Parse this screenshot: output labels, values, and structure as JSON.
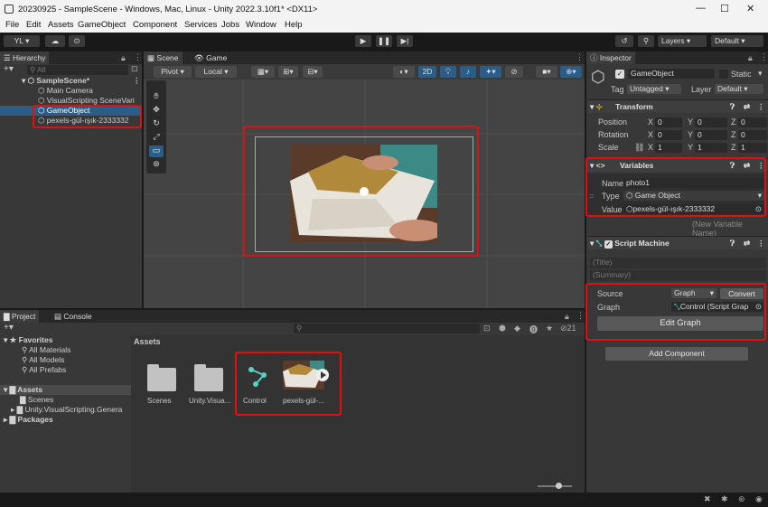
{
  "window": {
    "title": "20230925 - SampleScene - Windows, Mac, Linux - Unity 2022.3.10f1* <DX11>"
  },
  "menu": [
    "File",
    "Edit",
    "Assets",
    "GameObject",
    "Component",
    "Services",
    "Jobs",
    "Window",
    "Help"
  ],
  "toolbar": {
    "account": "YL ▾",
    "layers": "Layers",
    "layout": "Default"
  },
  "hierarchy": {
    "tab": "Hierarchy",
    "search_placeholder": "All",
    "scene": "SampleScene*",
    "items": [
      "Main Camera",
      "VisualScripting SceneVari",
      "GameObject",
      "pexels-gül-ışık-2333332"
    ]
  },
  "scene": {
    "tab_scene": "Scene",
    "tab_game": "Game",
    "pivot": "Pivot",
    "local": "Local",
    "mode_2d": "2D"
  },
  "project": {
    "tab_project": "Project",
    "tab_console": "Console",
    "hidden_count": "21",
    "favorites": "Favorites",
    "fav_items": [
      "All Materials",
      "All Models",
      "All Prefabs"
    ],
    "assets_label": "Assets",
    "asset_tree": [
      "Scenes",
      "Unity.VisualScripting.Genera"
    ],
    "packages": "Packages",
    "breadcrumb": "Assets",
    "grid": [
      "Scenes",
      "Unity.Visua...",
      "Control",
      "pexels-gül-..."
    ]
  },
  "inspector": {
    "tab": "Inspector",
    "object_name": "GameObject",
    "static_label": "Static",
    "tag_label": "Tag",
    "tag_value": "Untagged",
    "layer_label": "Layer",
    "layer_value": "Default",
    "transform": {
      "title": "Transform",
      "rows": [
        {
          "label": "Position",
          "x": "0",
          "y": "0",
          "z": "0"
        },
        {
          "label": "Rotation",
          "x": "0",
          "y": "0",
          "z": "0"
        },
        {
          "label": "Scale",
          "x": "1",
          "y": "1",
          "z": "1"
        }
      ]
    },
    "variables": {
      "title": "Variables",
      "name_label": "Name",
      "name_value": "photo1",
      "type_label": "Type",
      "type_value": "Game Object",
      "value_label": "Value",
      "value_value": "pexels-gül-ışık-2333332",
      "new_placeholder": "(New Variable Name)"
    },
    "script_machine": {
      "title": "Script Machine",
      "title_field": "(Title)",
      "summary_field": "(Summary)",
      "source_label": "Source",
      "source_value": "Graph",
      "convert": "Convert",
      "graph_label": "Graph",
      "graph_value": "Control (Script Grap",
      "edit_graph": "Edit Graph"
    },
    "add_component": "Add Component"
  },
  "colors": {
    "highlight": "#e01010",
    "selection": "#2c5d87"
  }
}
